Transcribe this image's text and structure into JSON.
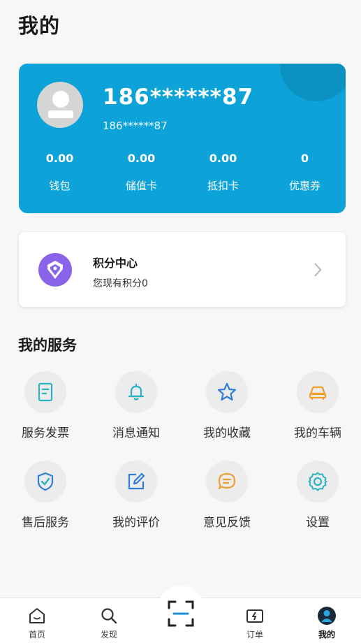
{
  "page": {
    "title": "我的"
  },
  "account": {
    "phone_main": "186******87",
    "phone_sub": "186******87",
    "stats": [
      {
        "value": "0.00",
        "label": "钱包"
      },
      {
        "value": "0.00",
        "label": "储值卡"
      },
      {
        "value": "0.00",
        "label": "抵扣卡"
      },
      {
        "value": "0",
        "label": "优惠券"
      }
    ]
  },
  "points": {
    "title": "积分中心",
    "subtitle": "您现有积分0",
    "icon": "diamond-icon",
    "icon_color": "#8a63e8"
  },
  "services": {
    "title": "我的服务",
    "items": [
      {
        "label": "服务发票",
        "icon": "invoice-icon",
        "color": "#2bb3c0"
      },
      {
        "label": "消息通知",
        "icon": "bell-icon",
        "color": "#2bb3c0"
      },
      {
        "label": "我的收藏",
        "icon": "star-icon",
        "color": "#2f7fd6"
      },
      {
        "label": "我的车辆",
        "icon": "car-icon",
        "color": "#f0a030"
      },
      {
        "label": "售后服务",
        "icon": "shield-check-icon",
        "color": "#2f7fd6"
      },
      {
        "label": "我的评价",
        "icon": "edit-icon",
        "color": "#2f7fd6"
      },
      {
        "label": "意见反馈",
        "icon": "feedback-icon",
        "color": "#f0a030"
      },
      {
        "label": "设置",
        "icon": "gear-icon",
        "color": "#2bb3c0"
      }
    ]
  },
  "nav": {
    "items": [
      {
        "label": "首页",
        "icon": "home-icon"
      },
      {
        "label": "发现",
        "icon": "search-icon"
      },
      {
        "label": "",
        "icon": "scan-icon"
      },
      {
        "label": "订单",
        "icon": "order-icon"
      },
      {
        "label": "我的",
        "icon": "profile-icon",
        "active": true
      }
    ]
  },
  "colors": {
    "card_bg": "#0ea3d8",
    "accent_teal": "#2bb3c0",
    "accent_blue": "#2f7fd6",
    "accent_orange": "#f0a030"
  }
}
